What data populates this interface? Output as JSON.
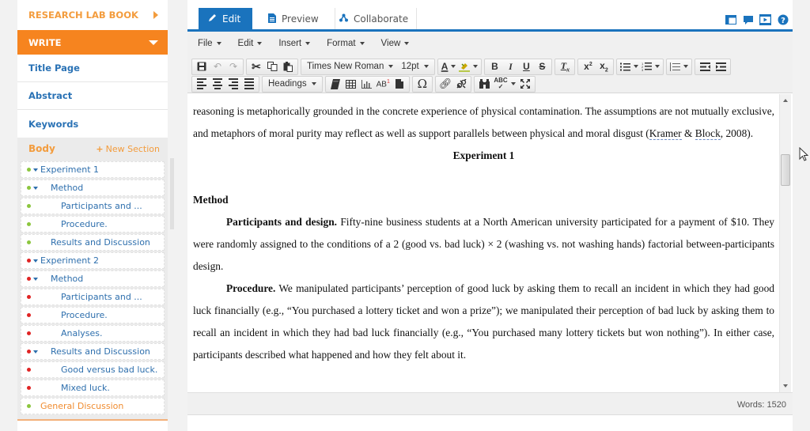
{
  "sidebar": {
    "research_lab_book": "RESEARCH LAB BOOK",
    "write": "WRITE",
    "links": [
      "Title Page",
      "Abstract",
      "Keywords"
    ],
    "body_label": "Body",
    "new_section_label": "New Section",
    "tree": [
      {
        "label": "Experiment 1",
        "level": 0,
        "status": "green",
        "expandable": true
      },
      {
        "label": "Method",
        "level": 1,
        "status": "green",
        "expandable": true
      },
      {
        "label": "Participants and ...",
        "level": 2,
        "status": "green",
        "expandable": false
      },
      {
        "label": "Procedure.",
        "level": 2,
        "status": "green",
        "expandable": false
      },
      {
        "label": "Results and Discussion",
        "level": 1,
        "status": "green",
        "expandable": false
      },
      {
        "label": "Experiment 2",
        "level": 0,
        "status": "red",
        "expandable": true
      },
      {
        "label": "Method",
        "level": 1,
        "status": "red",
        "expandable": true
      },
      {
        "label": "Participants and ...",
        "level": 2,
        "status": "red",
        "expandable": false
      },
      {
        "label": "Procedure.",
        "level": 2,
        "status": "red",
        "expandable": false
      },
      {
        "label": "Analyses.",
        "level": 2,
        "status": "red",
        "expandable": false
      },
      {
        "label": "Results and Discussion",
        "level": 1,
        "status": "red",
        "expandable": true
      },
      {
        "label": "Good versus bad luck.",
        "level": 2,
        "status": "red",
        "expandable": false
      },
      {
        "label": "Mixed luck.",
        "level": 2,
        "status": "red",
        "expandable": false
      },
      {
        "label": "General Discussion",
        "level": 0,
        "status": "green",
        "expandable": false,
        "highlight": "orange"
      }
    ],
    "colors": {
      "green": "#8cc63f",
      "red": "#e02424",
      "orange": "#f6841f",
      "link": "#2a72b5"
    }
  },
  "tabs": [
    {
      "label": "Edit",
      "icon": "pencil-icon",
      "active": true
    },
    {
      "label": "Preview",
      "icon": "document-icon",
      "active": false
    },
    {
      "label": "Collaborate",
      "icon": "collaborate-icon",
      "active": false
    }
  ],
  "top_icons": [
    "layout-icon",
    "comment-icon",
    "video-icon",
    "help-icon"
  ],
  "menubar": [
    "File",
    "Edit",
    "Insert",
    "Format",
    "View"
  ],
  "toolbar": {
    "font_family": "Times New Roman",
    "font_size": "12pt",
    "block_format": "Headings"
  },
  "document": {
    "paragraphs": {
      "p1a": "reasoning is metaphorically grounded in the concrete experience of physical contamination. The assumptions are not mutually exclusive, and metaphors of moral purity may reflect as well as support parallels between physical and moral disgust (",
      "p1_cite1": "Kramer",
      "p1_amp": " & ",
      "p1_cite2": "Block",
      "p1_end": ", 2008).",
      "heading_center": "Experiment 1",
      "heading_method": "Method",
      "participants_bold": "Participants and design.",
      "participants_text": " Fifty-nine business students at a North American university participated for a payment of $10. They were randomly assigned to the conditions of a 2 (good vs. bad luck) × 2 (washing vs. not washing hands) factorial between-participants design.",
      "procedure_bold": "Procedure.",
      "procedure_text": " We manipulated participants’ perception of good luck by asking them to recall an incident in which they had good luck financially (e.g., “You purchased a lottery ticket and won a prize”); we manipulated their perception of bad luck by asking them to recall an incident in which they had bad luck financially (e.g., “You purchased many lottery tickets but won nothing”). In either case, participants described what happened and how they felt about it."
    }
  },
  "status": {
    "words_label": "Words: 1520"
  }
}
